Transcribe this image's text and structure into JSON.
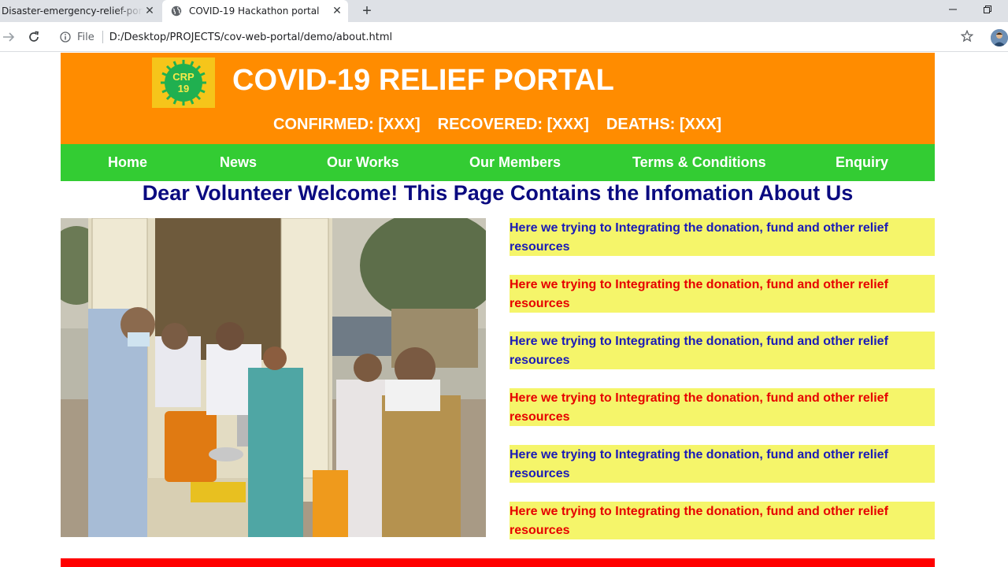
{
  "browser": {
    "tabs": [
      {
        "title": "Disaster-emergency-relief-portal",
        "active": false
      },
      {
        "title": "COVID-19 Hackathon portal",
        "active": true
      }
    ],
    "new_tab_icon": "plus-icon",
    "omnibox": {
      "scheme_label": "File",
      "url": "D:/Desktop/PROJECTS/cov-web-portal/demo/about.html"
    }
  },
  "header": {
    "logo_text_top": "CRP",
    "logo_text_bottom": "19",
    "title": "COVID-19 RELIEF PORTAL",
    "stats": {
      "confirmed": "CONFIRMED: [XXX]",
      "recovered": "RECOVERED: [XXX]",
      "deaths": "DEATHS: [XXX]"
    }
  },
  "nav": {
    "items": [
      {
        "label": "Home"
      },
      {
        "label": "News"
      },
      {
        "label": "Our Works"
      },
      {
        "label": "Our Members"
      },
      {
        "label": "Terms & Conditions"
      },
      {
        "label": "Enquiry"
      }
    ]
  },
  "main": {
    "welcome": "Dear Volunteer Welcome! This Page Contains the Infomation About Us",
    "info_items": [
      {
        "text": "Here we trying to Integrating the donation, fund and other relief resources",
        "color": "#1a1ab8"
      },
      {
        "text": "Here we trying to Integrating the donation, fund and other relief resources",
        "color": "#e60000"
      },
      {
        "text": "Here we trying to Integrating the donation, fund and other relief resources",
        "color": "#1a1ab8"
      },
      {
        "text": "Here we trying to Integrating the donation, fund and other relief resources",
        "color": "#e60000"
      },
      {
        "text": "Here we trying to Integrating the donation, fund and other relief resources",
        "color": "#1a1ab8"
      },
      {
        "text": "Here we trying to Integrating the donation, fund and other relief resources",
        "color": "#e60000"
      }
    ]
  },
  "colors": {
    "header_bg": "#ff8c00",
    "nav_bg": "#33cc33",
    "welcome_text": "#0a0a80",
    "info_bg": "#f5f56a",
    "footer_bg": "#ff0000"
  }
}
